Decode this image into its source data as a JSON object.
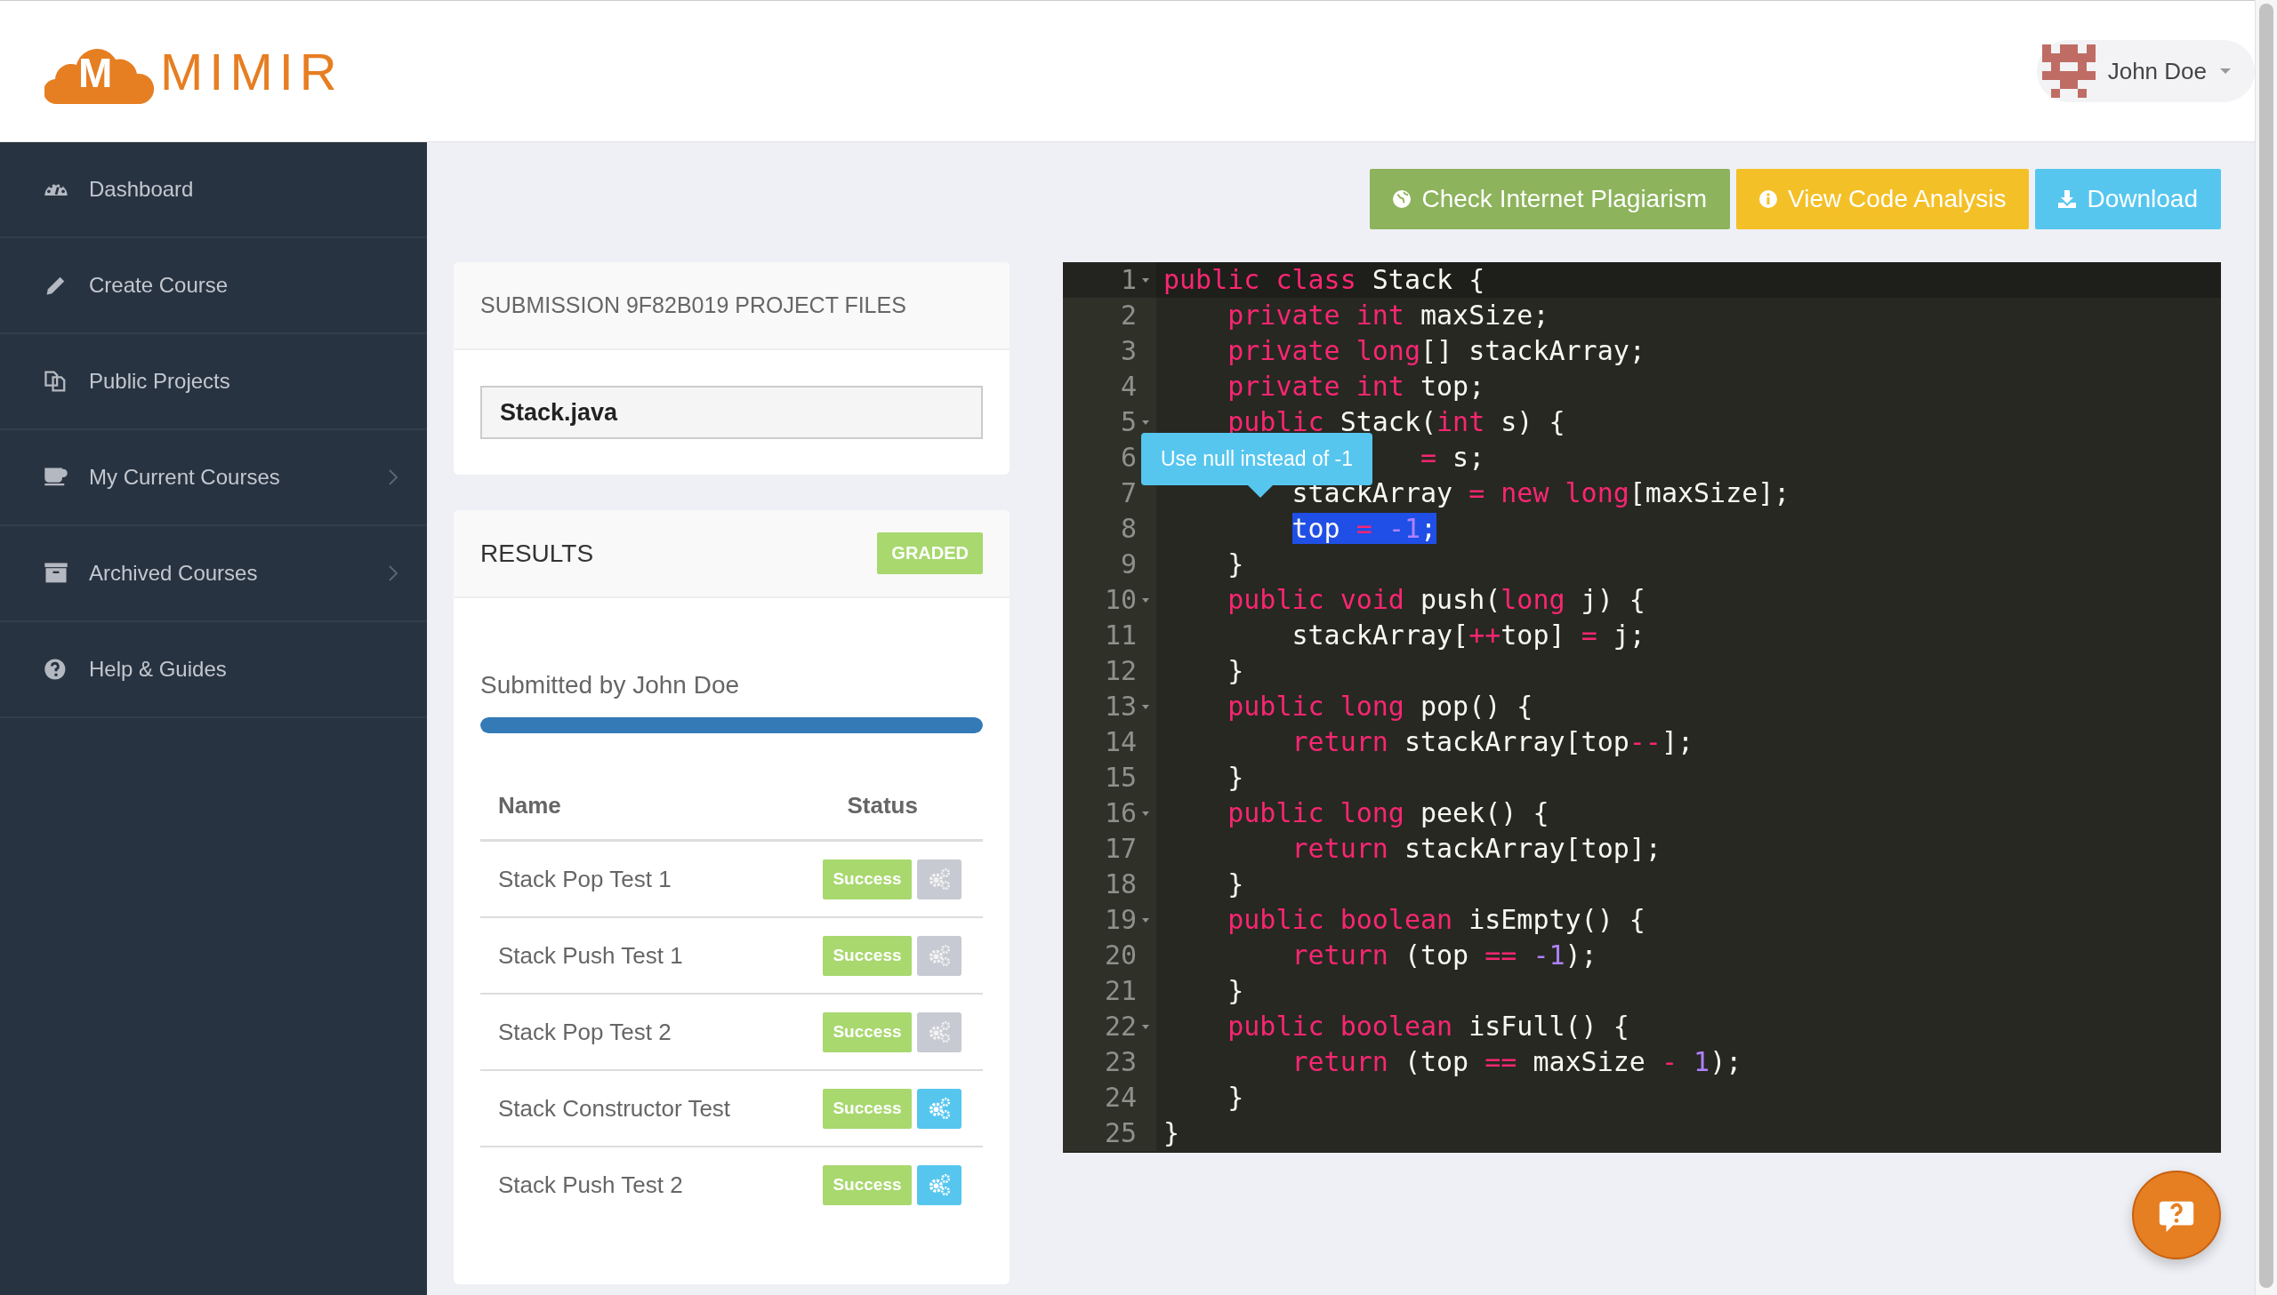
{
  "header": {
    "logo_letter": "M",
    "logo_text": "MIMIR",
    "user": {
      "name": "John Doe"
    }
  },
  "sidebar": {
    "items": [
      {
        "label": "Dashboard",
        "submenu": false
      },
      {
        "label": "Create Course",
        "submenu": false
      },
      {
        "label": "Public Projects",
        "submenu": false
      },
      {
        "label": "My Current Courses",
        "submenu": true
      },
      {
        "label": "Archived Courses",
        "submenu": true
      },
      {
        "label": "Help & Guides",
        "submenu": false
      }
    ]
  },
  "toolbar": {
    "buttons": [
      {
        "label": "Check Internet Plagiarism",
        "color": "#8db35c"
      },
      {
        "label": "View Code Analysis",
        "color": "#f4c027"
      },
      {
        "label": "Download",
        "color": "#56c6ef"
      }
    ]
  },
  "files_panel": {
    "title": "SUBMISSION 9F82B019 PROJECT FILES",
    "files": [
      "Stack.java"
    ]
  },
  "results_panel": {
    "title": "RESULTS",
    "badge": "GRADED",
    "submitted_by": "Submitted by John Doe",
    "progress": {
      "level": 1
    },
    "columns": [
      "Name",
      "Status"
    ],
    "tests": [
      {
        "name": "Stack Pop Test 1",
        "status": "Success",
        "details_enabled": false
      },
      {
        "name": "Stack Push Test 1",
        "status": "Success",
        "details_enabled": false
      },
      {
        "name": "Stack Pop Test 2",
        "status": "Success",
        "details_enabled": false
      },
      {
        "name": "Stack Constructor Test",
        "status": "Success",
        "details_enabled": true
      },
      {
        "name": "Stack Push Test 2",
        "status": "Success",
        "details_enabled": true
      }
    ]
  },
  "editor": {
    "tooltip": "Use null instead of -1",
    "lines": [
      {
        "number": "1",
        "fold": true,
        "active": true,
        "selected": false,
        "tokens": [
          {
            "kind": "keyword",
            "text": "public class"
          },
          {
            "kind": "plain",
            "text": " Stack {"
          }
        ]
      },
      {
        "number": "2",
        "fold": false,
        "active": false,
        "selected": false,
        "tokens": [
          {
            "kind": "keyword",
            "text": "    private int"
          },
          {
            "kind": "plain",
            "text": " maxSize;"
          }
        ]
      },
      {
        "number": "3",
        "fold": false,
        "active": false,
        "selected": false,
        "tokens": [
          {
            "kind": "keyword",
            "text": "    private long"
          },
          {
            "kind": "plain",
            "text": "[] stackArray;"
          }
        ]
      },
      {
        "number": "4",
        "fold": false,
        "active": false,
        "selected": false,
        "tokens": [
          {
            "kind": "keyword",
            "text": "    private int"
          },
          {
            "kind": "plain",
            "text": " top;"
          }
        ]
      },
      {
        "number": "5",
        "fold": true,
        "active": false,
        "selected": false,
        "tokens": [
          {
            "kind": "keyword",
            "text": "    public"
          },
          {
            "kind": "plain",
            "text": " Stack("
          },
          {
            "kind": "keyword",
            "text": "int"
          },
          {
            "kind": "plain",
            "text": " s) {"
          }
        ]
      },
      {
        "number": "6",
        "fold": false,
        "active": false,
        "selected": false,
        "tokens": [
          {
            "kind": "operator",
            "text": "                ="
          },
          {
            "kind": "plain",
            "text": " s;"
          }
        ]
      },
      {
        "number": "7",
        "fold": false,
        "active": false,
        "selected": false,
        "tokens": [
          {
            "kind": "plain",
            "text": "        stackArray "
          },
          {
            "kind": "operator",
            "text": "= "
          },
          {
            "kind": "keyword",
            "text": "new long"
          },
          {
            "kind": "plain",
            "text": "[maxSize];"
          }
        ]
      },
      {
        "number": "8",
        "fold": false,
        "active": false,
        "selected": true,
        "tokens": [
          {
            "kind": "plain",
            "text": "        top "
          },
          {
            "kind": "operator",
            "text": "= "
          },
          {
            "kind": "number",
            "text": "-1"
          },
          {
            "kind": "plain",
            "text": ";"
          }
        ]
      },
      {
        "number": "9",
        "fold": false,
        "active": false,
        "selected": false,
        "tokens": [
          {
            "kind": "plain",
            "text": "    }"
          }
        ]
      },
      {
        "number": "10",
        "fold": true,
        "active": false,
        "selected": false,
        "tokens": [
          {
            "kind": "keyword",
            "text": "    public void"
          },
          {
            "kind": "plain",
            "text": " push("
          },
          {
            "kind": "keyword",
            "text": "long"
          },
          {
            "kind": "plain",
            "text": " j) {"
          }
        ]
      },
      {
        "number": "11",
        "fold": false,
        "active": false,
        "selected": false,
        "tokens": [
          {
            "kind": "plain",
            "text": "        stackArray["
          },
          {
            "kind": "operator",
            "text": "++"
          },
          {
            "kind": "plain",
            "text": "top] "
          },
          {
            "kind": "operator",
            "text": "="
          },
          {
            "kind": "plain",
            "text": " j;"
          }
        ]
      },
      {
        "number": "12",
        "fold": false,
        "active": false,
        "selected": false,
        "tokens": [
          {
            "kind": "plain",
            "text": "    }"
          }
        ]
      },
      {
        "number": "13",
        "fold": true,
        "active": false,
        "selected": false,
        "tokens": [
          {
            "kind": "keyword",
            "text": "    public long"
          },
          {
            "kind": "plain",
            "text": " pop() {"
          }
        ]
      },
      {
        "number": "14",
        "fold": false,
        "active": false,
        "selected": false,
        "tokens": [
          {
            "kind": "keyword",
            "text": "        return"
          },
          {
            "kind": "plain",
            "text": " stackArray[top"
          },
          {
            "kind": "operator",
            "text": "--"
          },
          {
            "kind": "plain",
            "text": "];"
          }
        ]
      },
      {
        "number": "15",
        "fold": false,
        "active": false,
        "selected": false,
        "tokens": [
          {
            "kind": "plain",
            "text": "    }"
          }
        ]
      },
      {
        "number": "16",
        "fold": true,
        "active": false,
        "selected": false,
        "tokens": [
          {
            "kind": "keyword",
            "text": "    public long"
          },
          {
            "kind": "plain",
            "text": " peek() {"
          }
        ]
      },
      {
        "number": "17",
        "fold": false,
        "active": false,
        "selected": false,
        "tokens": [
          {
            "kind": "keyword",
            "text": "        return"
          },
          {
            "kind": "plain",
            "text": " stackArray[top];"
          }
        ]
      },
      {
        "number": "18",
        "fold": false,
        "active": false,
        "selected": false,
        "tokens": [
          {
            "kind": "plain",
            "text": "    }"
          }
        ]
      },
      {
        "number": "19",
        "fold": true,
        "active": false,
        "selected": false,
        "tokens": [
          {
            "kind": "keyword",
            "text": "    public boolean"
          },
          {
            "kind": "plain",
            "text": " isEmpty() {"
          }
        ]
      },
      {
        "number": "20",
        "fold": false,
        "active": false,
        "selected": false,
        "tokens": [
          {
            "kind": "keyword",
            "text": "        return"
          },
          {
            "kind": "plain",
            "text": " (top "
          },
          {
            "kind": "operator",
            "text": "== "
          },
          {
            "kind": "number",
            "text": "-1"
          },
          {
            "kind": "plain",
            "text": ");"
          }
        ]
      },
      {
        "number": "21",
        "fold": false,
        "active": false,
        "selected": false,
        "tokens": [
          {
            "kind": "plain",
            "text": "    }"
          }
        ]
      },
      {
        "number": "22",
        "fold": true,
        "active": false,
        "selected": false,
        "tokens": [
          {
            "kind": "keyword",
            "text": "    public boolean"
          },
          {
            "kind": "plain",
            "text": " isFull() {"
          }
        ]
      },
      {
        "number": "23",
        "fold": false,
        "active": false,
        "selected": false,
        "tokens": [
          {
            "kind": "keyword",
            "text": "        return"
          },
          {
            "kind": "plain",
            "text": " (top "
          },
          {
            "kind": "operator",
            "text": "=="
          },
          {
            "kind": "plain",
            "text": " maxSize "
          },
          {
            "kind": "operator",
            "text": "- "
          },
          {
            "kind": "number",
            "text": "1"
          },
          {
            "kind": "plain",
            "text": ");"
          }
        ]
      },
      {
        "number": "24",
        "fold": false,
        "active": false,
        "selected": false,
        "tokens": [
          {
            "kind": "plain",
            "text": "    }"
          }
        ]
      },
      {
        "number": "25",
        "fold": false,
        "active": false,
        "selected": false,
        "tokens": [
          {
            "kind": "plain",
            "text": "}"
          }
        ]
      }
    ]
  }
}
